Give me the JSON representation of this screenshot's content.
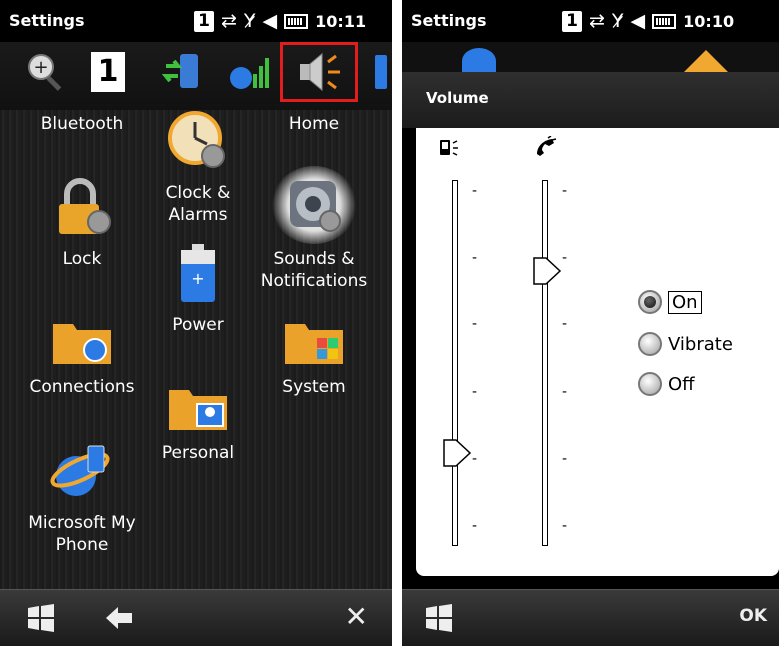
{
  "left_screen": {
    "status_title": "Settings",
    "sim_number": "1",
    "clock": "10:11",
    "tabs": [
      {
        "icon": "zoom-icon"
      },
      {
        "icon": "page-number-icon",
        "label": "1"
      },
      {
        "icon": "sync-icon"
      },
      {
        "icon": "connection-icon"
      },
      {
        "icon": "speaker-icon",
        "selected": true
      },
      {
        "icon": "battery-icon"
      }
    ],
    "apps": [
      {
        "name": "bluetooth",
        "label": "Bluetooth"
      },
      {
        "name": "clock-alarms",
        "label": "Clock &\nAlarms"
      },
      {
        "name": "home",
        "label": "Home"
      },
      {
        "name": "lock",
        "label": "Lock"
      },
      {
        "name": "sounds-notifications",
        "label": "Sounds &\nNotifications"
      },
      {
        "name": "power",
        "label": "Power"
      },
      {
        "name": "connections",
        "label": "Connections"
      },
      {
        "name": "system",
        "label": "System"
      },
      {
        "name": "personal",
        "label": "Personal"
      },
      {
        "name": "microsoft-my-phone",
        "label": "Microsoft My\nPhone"
      }
    ],
    "softkeys": {
      "left_icon": "windows-start-icon",
      "back_icon": "back-arrow-icon",
      "close": "✕"
    }
  },
  "right_screen": {
    "status_title": "Settings",
    "sim_number": "1",
    "clock": "10:10",
    "dialog_title": "Volume",
    "slider_icons": [
      "phone-ringer-icon",
      "call-volume-icon"
    ],
    "tick_mark": "-",
    "ringer_slider_level": 0.25,
    "call_slider_level": 0.75,
    "options": [
      {
        "label": "On",
        "selected": true
      },
      {
        "label": "Vibrate",
        "selected": false
      },
      {
        "label": "Off",
        "selected": false
      }
    ],
    "softkey_right": "OK"
  },
  "colors": {
    "highlight": "#e01e1e",
    "dialog_bg": "#ffffff",
    "header_bg": "#2a2a2a"
  }
}
